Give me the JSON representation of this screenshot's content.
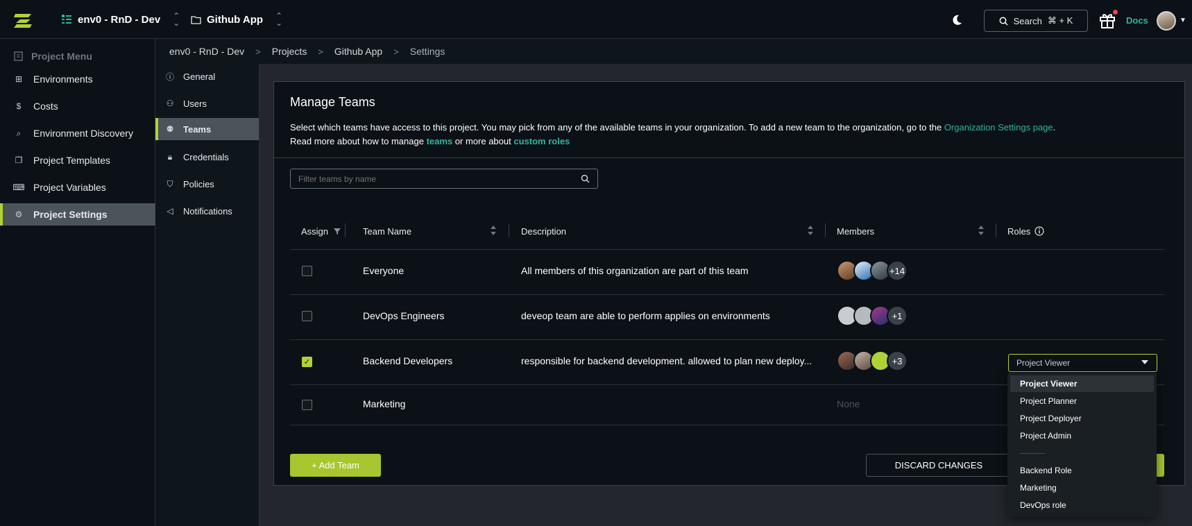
{
  "topbar": {
    "org": "env0 - RnD - Dev",
    "project": "Github App",
    "search_label": "Search",
    "search_shortcut": "⌘ + K",
    "docs_label": "Docs"
  },
  "sidebar": {
    "header": "Project Menu",
    "items": [
      {
        "label": "Environments",
        "icon": "environments-icon"
      },
      {
        "label": "Costs",
        "icon": "dollar-icon"
      },
      {
        "label": "Environment Discovery",
        "icon": "discovery-icon"
      },
      {
        "label": "Project Templates",
        "icon": "templates-icon"
      },
      {
        "label": "Project Variables",
        "icon": "variables-icon"
      },
      {
        "label": "Project Settings",
        "icon": "gear-icon",
        "active": true
      }
    ]
  },
  "breadcrumb": [
    "env0 - RnD - Dev",
    "Projects",
    "Github App",
    "Settings"
  ],
  "subnav": [
    {
      "label": "General",
      "icon": "info-icon"
    },
    {
      "label": "Users",
      "icon": "user-icon"
    },
    {
      "label": "Teams",
      "icon": "teams-icon",
      "active": true
    },
    {
      "label": "Credentials",
      "icon": "lock-icon"
    },
    {
      "label": "Policies",
      "icon": "shield-icon"
    },
    {
      "label": "Notifications",
      "icon": "megaphone-icon"
    }
  ],
  "manage_teams": {
    "title": "Manage Teams",
    "desc_1": "Select which teams have access to this project. You may pick from any of the available teams in your organization. To add a new team to the organization, go to the",
    "desc_link": "Organization Settings page",
    "desc_1_end": ".",
    "desc_2a": "Read more about how to manage",
    "desc_2_link_teams": "teams",
    "desc_2b": "or more about",
    "desc_2_link_roles": "custom roles",
    "filter_placeholder": "Filter teams by name"
  },
  "table": {
    "headers": [
      "Assign",
      "Team Name",
      "Description",
      "Members",
      "Roles"
    ],
    "rows": [
      {
        "assigned": false,
        "name": "Everyone",
        "description": "All members of this organization are part of this team",
        "members_more": "+14"
      },
      {
        "assigned": false,
        "name": "DevOps Engineers",
        "description": "deveop team are able to perform applies on environments",
        "members_more": "+1"
      },
      {
        "assigned": true,
        "name": "Backend Developers",
        "description": "responsible for backend development. allowed to plan new deploy...",
        "members_more": "+3",
        "role": "Project Viewer"
      },
      {
        "assigned": false,
        "name": "Marketing",
        "description": "",
        "members_none": "None"
      }
    ]
  },
  "buttons": {
    "add_team": "+ Add Team",
    "discard": "DISCARD CHANGES"
  },
  "role_dropdown": {
    "options": [
      "Project Viewer",
      "Project Planner",
      "Project Deployer",
      "Project Admin"
    ],
    "separator": "------------",
    "custom_options": [
      "Backend Role",
      "Marketing",
      "DevOps role"
    ]
  },
  "colors": {
    "accent": "#b1d236",
    "link": "#2fb69e",
    "background": "#0b1116"
  }
}
